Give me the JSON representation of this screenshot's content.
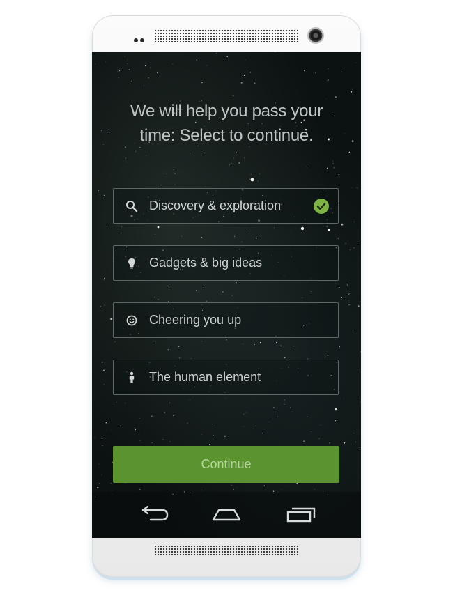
{
  "headline": {
    "line1": "We will help you pass your",
    "line2": "time: Select to continue."
  },
  "options": [
    {
      "label": "Discovery & exploration",
      "icon": "search-icon",
      "selected": true
    },
    {
      "label": "Gadgets & big ideas",
      "icon": "lightbulb-icon",
      "selected": false
    },
    {
      "label": "Cheering you up",
      "icon": "smiley-icon",
      "selected": false
    },
    {
      "label": "The human element",
      "icon": "person-icon",
      "selected": false
    }
  ],
  "continue_button": {
    "label": "Continue"
  },
  "nav_bar": {
    "buttons": [
      "back-icon",
      "home-icon",
      "recent-apps-icon"
    ]
  },
  "colors": {
    "accent_green": "#5b942e",
    "check_green": "#7cb342",
    "background": "#0c1111",
    "option_border": "#5d6766"
  }
}
